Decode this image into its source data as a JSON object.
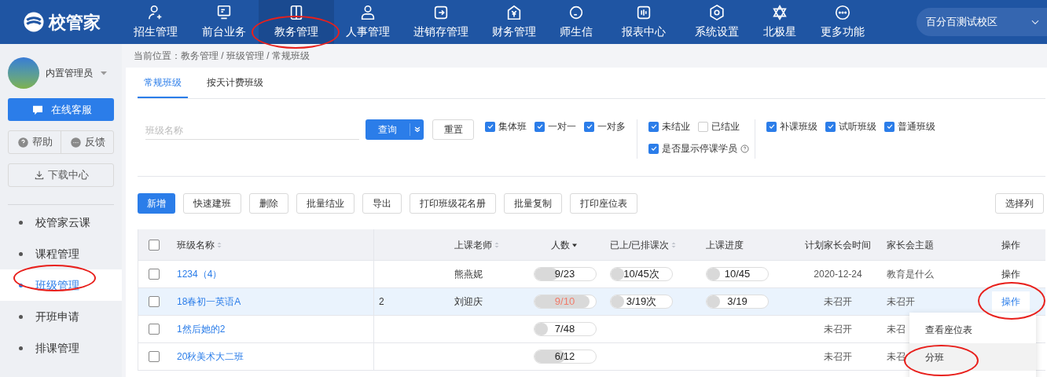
{
  "topbar": {
    "logo": "校管家",
    "nav": [
      {
        "label": "招生管理",
        "selected": false
      },
      {
        "label": "前台业务",
        "selected": false
      },
      {
        "label": "教务管理",
        "selected": true
      },
      {
        "label": "人事管理",
        "selected": false
      },
      {
        "label": "进销存管理",
        "selected": false
      },
      {
        "label": "财务管理",
        "selected": false
      },
      {
        "label": "师生信",
        "selected": false
      },
      {
        "label": "报表中心",
        "selected": false
      },
      {
        "label": "系统设置",
        "selected": false
      },
      {
        "label": "北极星",
        "selected": false
      },
      {
        "label": "更多功能",
        "selected": false
      }
    ],
    "campus": "百分百测试校区"
  },
  "sidebar": {
    "user": "内置管理员",
    "service": "在线客服",
    "help": "帮助",
    "feedback": "反馈",
    "download": "下载中心",
    "items": [
      {
        "label": "校管家云课",
        "selected": false
      },
      {
        "label": "课程管理",
        "selected": false
      },
      {
        "label": "班级管理",
        "selected": true
      },
      {
        "label": "开班申请",
        "selected": false
      },
      {
        "label": "排课管理",
        "selected": false
      }
    ]
  },
  "breadcrumb": "当前位置：教务管理 / 班级管理 / 常规班级",
  "tabs": [
    {
      "label": "常规班级",
      "selected": true
    },
    {
      "label": "按天计费班级",
      "selected": false
    }
  ],
  "search": {
    "placeholder": "班级名称",
    "query": "查询",
    "reset": "重置"
  },
  "filters": [
    {
      "options": [
        {
          "label": "集体班",
          "checked": true,
          "kind": "plain"
        },
        {
          "label": "一对一",
          "checked": true,
          "kind": "plain"
        },
        {
          "label": "一对多",
          "checked": true,
          "kind": "plain"
        }
      ]
    },
    {
      "options": [
        {
          "label": "未结业",
          "checked": true,
          "kind": "plain"
        },
        {
          "label": "已结业",
          "checked": false,
          "kind": "plain"
        },
        {
          "label": "是否显示停课学员",
          "checked": true,
          "kind": "help"
        }
      ]
    },
    {
      "options": [
        {
          "label": "补课班级",
          "checked": true,
          "kind": "plain"
        },
        {
          "label": "试听班级",
          "checked": true,
          "kind": "plain"
        },
        {
          "label": "普通班级",
          "checked": true,
          "kind": "plain"
        }
      ]
    }
  ],
  "toolbar": [
    {
      "label": "新增",
      "kind": "primary"
    },
    {
      "label": "快速建班",
      "kind": "default"
    },
    {
      "label": "删除",
      "kind": "default"
    },
    {
      "label": "批量结业",
      "kind": "default"
    },
    {
      "label": "导出",
      "kind": "default"
    },
    {
      "label": "打印班级花名册",
      "kind": "default"
    },
    {
      "label": "批量复制",
      "kind": "default"
    },
    {
      "label": "打印座位表",
      "kind": "default"
    }
  ],
  "choose_columns": "选择列",
  "table": {
    "select_all_checked": false,
    "columns": [
      {
        "label": "班级名称",
        "sortable": true,
        "descending": false
      },
      {
        "label": "上课老师",
        "sortable": true,
        "descending": false
      },
      {
        "label": "人数",
        "sortable": true,
        "descending": true
      },
      {
        "label": "已上/已排课次",
        "sortable": true,
        "descending": false
      },
      {
        "label": "上课进度",
        "sortable": false
      },
      {
        "label": "计划家长会时间",
        "sortable": false
      },
      {
        "label": "家长会主题",
        "sortable": false
      },
      {
        "label": "操作",
        "sortable": false
      }
    ],
    "rows": [
      {
        "checked": false,
        "name": "1234（4）",
        "teacher": "熊燕妮",
        "count": {
          "text": "9/23",
          "level": 0.39,
          "full": false
        },
        "lessons": {
          "text": "10/45次",
          "level": 0.22
        },
        "progress": {
          "text": "10/45",
          "level": 0.22
        },
        "meeting": "2020-12-24",
        "topic": "教育是什么",
        "action": "操作",
        "hovered": false
      },
      {
        "checked": false,
        "name": "18春初一英语A",
        "column_2": "2",
        "teacher": "刘迎庆",
        "count": {
          "text": "9/10",
          "level": 0.9,
          "full": true
        },
        "lessons": {
          "text": "3/19次",
          "level": 0.16
        },
        "progress": {
          "text": "3/19",
          "level": 0.16
        },
        "meeting": "未召开",
        "topic": "未召开",
        "action": "操作",
        "hovered": true
      },
      {
        "checked": false,
        "name": "1然后她的2",
        "count": {
          "text": "7/48",
          "level": 0.15,
          "full": false
        },
        "meeting": "未召开",
        "topic": "未召",
        "hovered": false
      },
      {
        "checked": false,
        "name": "20秋美术大二班",
        "count": {
          "text": "6/12",
          "level": 0.5,
          "full": false
        },
        "meeting": "未召开",
        "topic": "未召",
        "hovered": false
      }
    ]
  },
  "action_menu": [
    {
      "label": "查看座位表",
      "selected": false
    },
    {
      "label": "分班",
      "selected": true
    }
  ]
}
